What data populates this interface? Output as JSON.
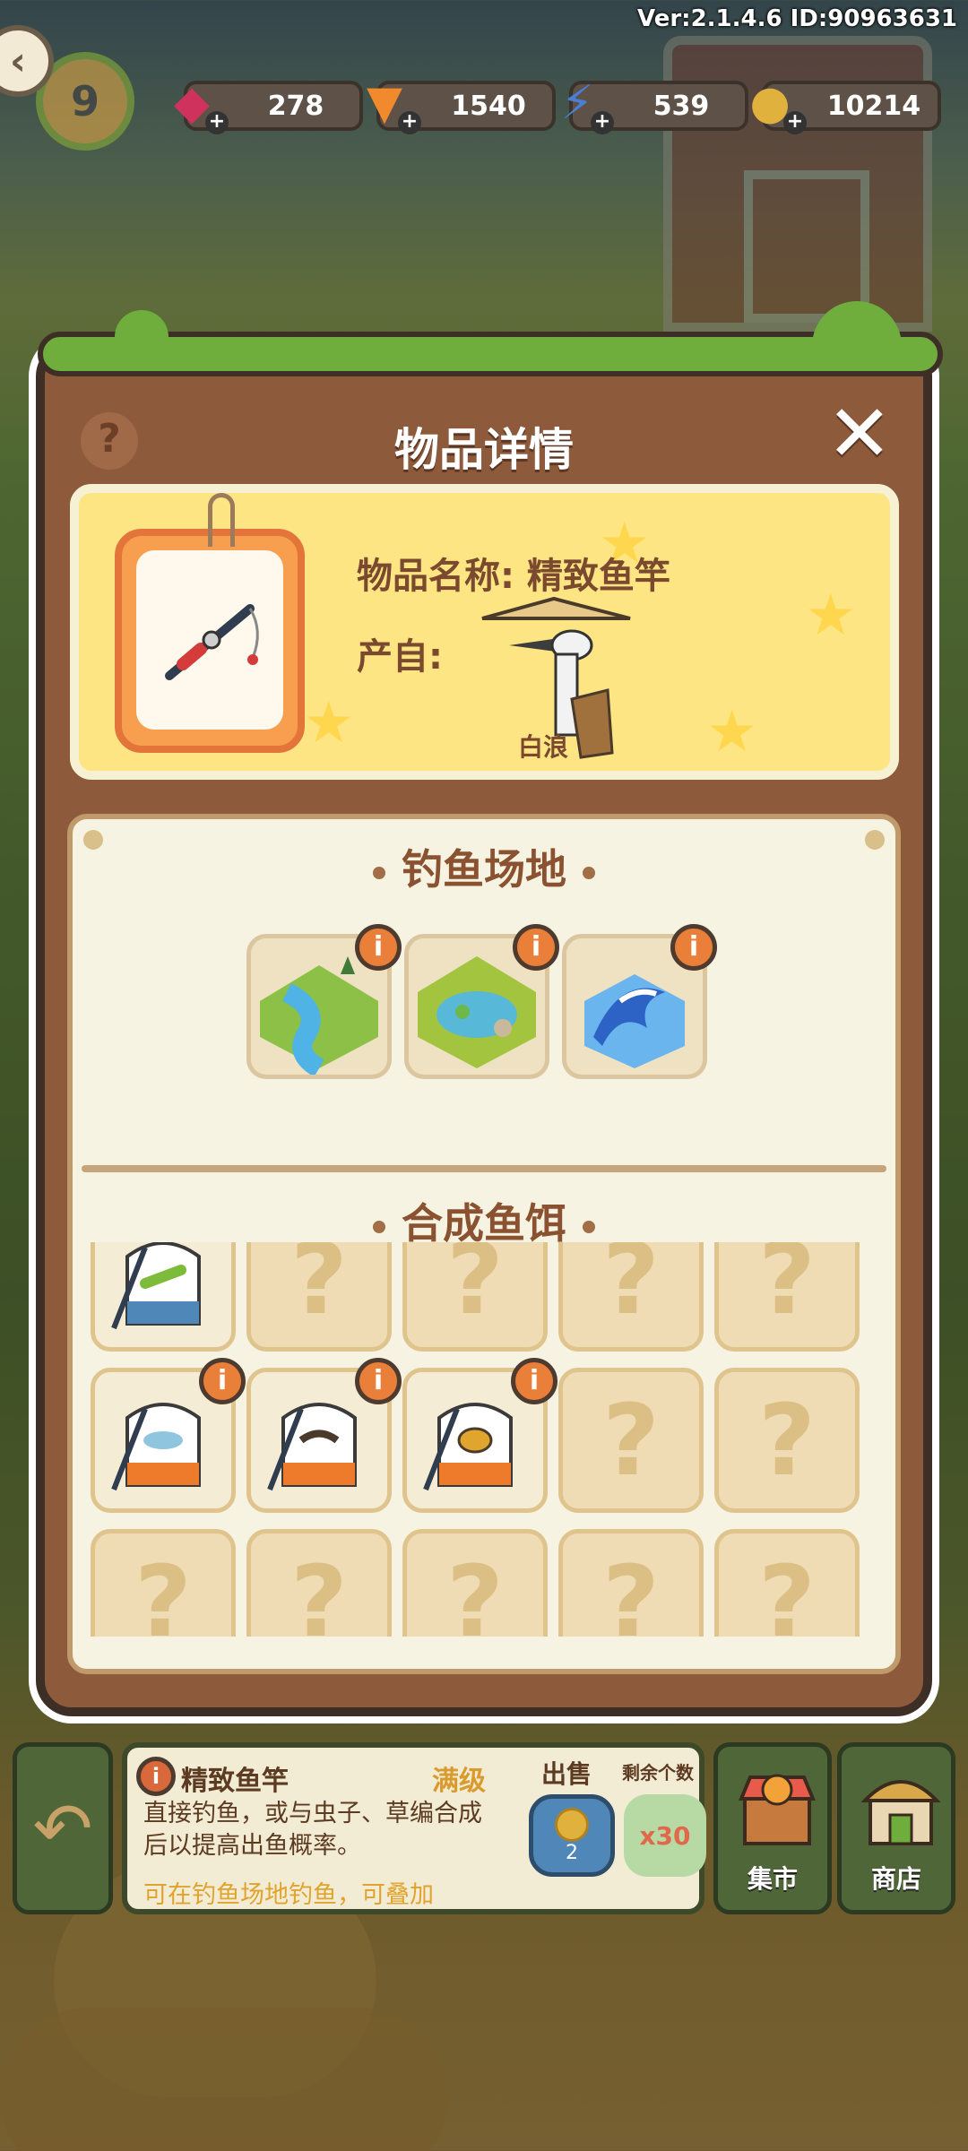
{
  "version": "Ver:2.1.4.6 ID:90963631",
  "player": {
    "level_fragment": "9"
  },
  "resources": [
    {
      "name": "gem",
      "icon": "gem-icon",
      "value": "278",
      "color": "#d0325e"
    },
    {
      "name": "carrot",
      "icon": "carrot-icon",
      "value": "1540",
      "color": "#f08a2c"
    },
    {
      "name": "energy",
      "icon": "lightning-icon",
      "value": "539",
      "color": "#4a7fd6"
    },
    {
      "name": "coin",
      "icon": "coin-icon",
      "value": "10214",
      "color": "#e0b13c"
    }
  ],
  "modal": {
    "title": "物品详情",
    "help": "?",
    "close": "✕",
    "item_name": "物品名称: 精致鱼竿",
    "item_from": "产自:",
    "npc_name": "白浪"
  },
  "fishing": {
    "venue_title": "钓鱼场地",
    "venues": [
      {
        "name": "river",
        "badge": "i"
      },
      {
        "name": "pond",
        "badge": "i"
      },
      {
        "name": "sea",
        "badge": "i"
      }
    ],
    "bait_title": "合成鱼饵",
    "unknown_glyph": "?"
  },
  "info_bar": {
    "item_title": "精致鱼竿",
    "level": "满级",
    "description": "直接钓鱼，或与虫子、草编合成后以提高出鱼概率。",
    "extra": "可在钓鱼场地钓鱼，可叠加",
    "sell_label": "出售",
    "remaining_label": "剩余个数",
    "sell_price": "2",
    "count": "x30"
  },
  "side_buttons": {
    "market": "集市",
    "shop": "商店"
  }
}
